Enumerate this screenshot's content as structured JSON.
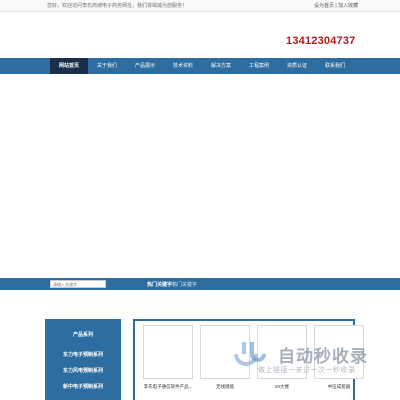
{
  "topbar": {
    "welcome": "您好，欢迎访问李氏商城电子商务网址，我们将竭诚为您服务！",
    "links": "设为首页 | 加入收藏"
  },
  "header": {
    "phone": "13412304737"
  },
  "nav": {
    "items": [
      {
        "label": "网站首页",
        "active": true
      },
      {
        "label": "关于我们",
        "active": false
      },
      {
        "label": "产品展示",
        "active": false
      },
      {
        "label": "技术资料",
        "active": false
      },
      {
        "label": "解决方案",
        "active": false
      },
      {
        "label": "工程案例",
        "active": false
      },
      {
        "label": "资质认证",
        "active": false
      },
      {
        "label": "联系我们",
        "active": false
      }
    ]
  },
  "search": {
    "placeholder": "请输入关键字",
    "hot_label": "热门关键字：",
    "hot_word": "热门关键字"
  },
  "sidebar": {
    "title": "产品系列",
    "items": [
      "东力电子预制系列",
      "东力风电预制系列",
      "新中电子预制系列"
    ]
  },
  "products": [
    {
      "name": "李氏电子通信软件产品..."
    },
    {
      "name": "无线储能"
    },
    {
      "name": "20大楼"
    },
    {
      "name": "中压成套器"
    }
  ],
  "watermark": {
    "title": "自动秒收录",
    "subtitle": "做上链接一来访一次一秒收录"
  },
  "colors": {
    "nav_bg": "#2e6d9f",
    "nav_active": "#1a2f4a",
    "phone": "#b0191c"
  }
}
